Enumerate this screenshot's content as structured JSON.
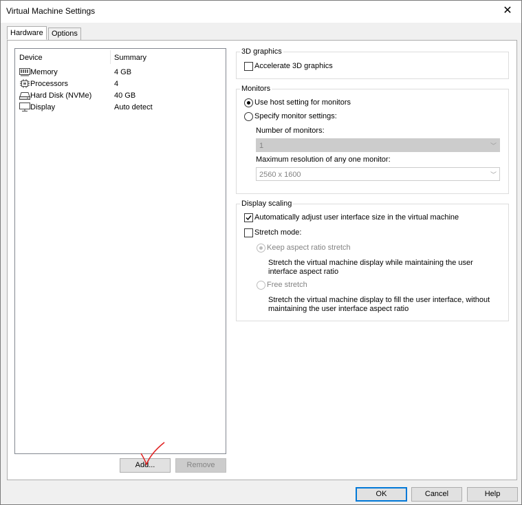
{
  "window": {
    "title": "Virtual Machine Settings"
  },
  "tabs": [
    {
      "label": "Hardware"
    },
    {
      "label": "Options"
    }
  ],
  "device_list": {
    "headers": {
      "device": "Device",
      "summary": "Summary"
    },
    "rows": [
      {
        "name": "Memory",
        "summary": "4 GB",
        "icon": "memory-icon"
      },
      {
        "name": "Processors",
        "summary": "4",
        "icon": "cpu-icon"
      },
      {
        "name": "Hard Disk (NVMe)",
        "summary": "40 GB",
        "icon": "hard-disk-icon"
      },
      {
        "name": "Display",
        "summary": "Auto detect",
        "icon": "monitor-icon"
      }
    ]
  },
  "buttons": {
    "add": "Add...",
    "remove": "Remove",
    "ok": "OK",
    "cancel": "Cancel",
    "help": "Help"
  },
  "graphics": {
    "title": "3D graphics",
    "accelerate": "Accelerate 3D graphics"
  },
  "monitors": {
    "title": "Monitors",
    "use_host": "Use host setting for monitors",
    "specify": "Specify monitor settings:",
    "num_label": "Number of monitors:",
    "num_value": "1",
    "res_label": "Maximum resolution of any one monitor:",
    "res_value": "2560 x 1600"
  },
  "scaling": {
    "title": "Display scaling",
    "auto_adjust": "Automatically adjust user interface size in the virtual machine",
    "stretch_mode": "Stretch mode:",
    "keep_aspect": "Keep aspect ratio stretch",
    "keep_aspect_desc_1": "Stretch the virtual machine display while maintaining the user",
    "keep_aspect_desc_2": "interface aspect ratio",
    "free_stretch": "Free stretch",
    "free_stretch_desc_1": "Stretch the virtual machine display to fill the user interface, without",
    "free_stretch_desc_2": "maintaining the user interface aspect ratio"
  },
  "state": {
    "accelerate_checked": false,
    "monitor_mode": "use_host",
    "auto_adjust_checked": true,
    "stretch_mode_checked": false,
    "stretch_option": "keep_aspect"
  },
  "colors": {
    "accent": "#0078d7",
    "annotation": "#e02020"
  }
}
